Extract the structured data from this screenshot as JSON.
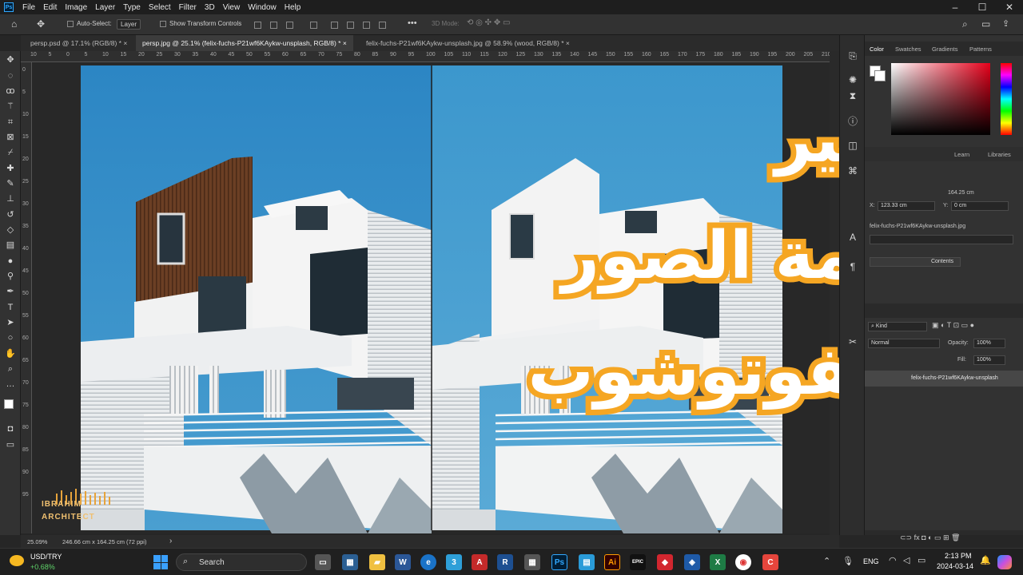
{
  "menubar": {
    "logo": "Ps",
    "items": [
      "File",
      "Edit",
      "Image",
      "Layer",
      "Type",
      "Select",
      "Filter",
      "3D",
      "View",
      "Window",
      "Help"
    ],
    "win_min": "–",
    "win_max": "☐",
    "win_close": "✕"
  },
  "options": {
    "auto_select_label": "Auto-Select:",
    "auto_select_value": "Layer",
    "show_transform_label": "Show Transform Controls",
    "mode_label": "3D Mode:",
    "more": "•••"
  },
  "tabs": [
    {
      "label": "persp.psd @ 17.1% (RGB/8) *"
    },
    {
      "label": "persp.jpg @ 25.1% (felix-fuchs-P21wf6KAykw-unsplash, RGB/8) *"
    },
    {
      "label": "felix-fuchs-P21wf6KAykw-unsplash.jpg @ 58.9% (wood, RGB/8) *"
    }
  ],
  "tab_close": "×",
  "ruler": {
    "top": [
      "10",
      "5",
      "0",
      "5",
      "10",
      "15",
      "20",
      "25",
      "30",
      "35",
      "40",
      "45",
      "50",
      "55",
      "60",
      "65",
      "70",
      "75",
      "80",
      "85",
      "90",
      "95",
      "100",
      "105",
      "110",
      "115",
      "120",
      "125",
      "130",
      "135",
      "140",
      "145",
      "150",
      "155",
      "160",
      "165",
      "170",
      "175",
      "180",
      "185",
      "190",
      "195",
      "200",
      "205",
      "210"
    ],
    "left": [
      "0",
      "5",
      "10",
      "15",
      "20",
      "25",
      "30",
      "35",
      "40",
      "45",
      "50",
      "55",
      "60",
      "65",
      "70",
      "75",
      "80",
      "85",
      "90",
      "95"
    ]
  },
  "status": {
    "zoom": "25.09%",
    "doc": "246.66 cm x 164.25 cm (72 ppi)",
    "arrow": "›"
  },
  "panels": {
    "color_tabs": [
      "Color",
      "Swatches",
      "Gradients",
      "Patterns"
    ],
    "props_tabs": [
      "Learn",
      "Libraries"
    ],
    "w_value": "164.25 cm",
    "x_label": "X:",
    "x_value": "123.33 cm",
    "y_label": "Y:",
    "y_value": "0 cm",
    "file_name": "felix-fuchs-P21wf6KAykw-unsplash.jpg",
    "contents_btn": "Contents",
    "kind_label": "Kind",
    "blend_mode": "Normal",
    "opacity_label": "Opacity:",
    "opacity_value": "100%",
    "fill_label": "Fill:",
    "fill_value": "100%",
    "layer_name": "felix-fuchs-P21wf6KAykw-unsplash",
    "bottom_icons": "⊂⊃  fx  ◘  ◐  ▭  ⊞  🗑"
  },
  "overlay": {
    "line1": "تغيير",
    "line2": "خامة الصور",
    "line3": "بالفوتوشوب",
    "stroke_color": "#f5a623"
  },
  "logo": {
    "top": "IBRAHIM",
    "bottom": "ARCHITECT"
  },
  "taskbar": {
    "ticker": "USD/TRY",
    "change": "+0.68%",
    "search": "Search",
    "lang": "ENG",
    "time": "2:13 PM",
    "date": "2024-03-14"
  },
  "colors": {
    "sky": "#3b8fc8",
    "wood": "#6b3f24",
    "accent": "#f5a623"
  }
}
